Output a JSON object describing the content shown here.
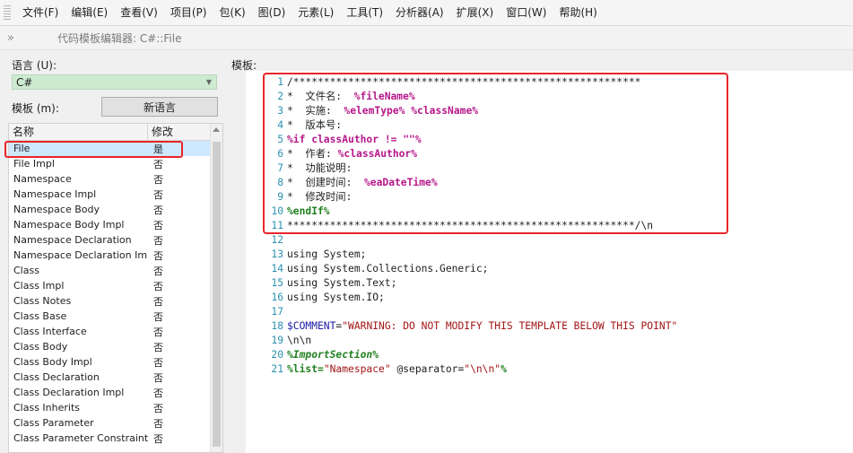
{
  "menu": [
    "文件(F)",
    "编辑(E)",
    "查看(V)",
    "项目(P)",
    "包(K)",
    "图(D)",
    "元素(L)",
    "工具(T)",
    "分析器(A)",
    "扩展(X)",
    "窗口(W)",
    "帮助(H)"
  ],
  "toolbar": {
    "chevron": "»",
    "title": "代码模板编辑器:  C#::File"
  },
  "left": {
    "language_label": "语言 (U):",
    "language_value": "C#",
    "template_label": "模板 (m):",
    "new_language_button": "新语言",
    "col_name": "名称",
    "col_modified": "修改",
    "rows": [
      {
        "name": "File",
        "modified": "是"
      },
      {
        "name": "File Impl",
        "modified": "否"
      },
      {
        "name": "Namespace",
        "modified": "否"
      },
      {
        "name": "Namespace Impl",
        "modified": "否"
      },
      {
        "name": "Namespace Body",
        "modified": "否"
      },
      {
        "name": "Namespace Body Impl",
        "modified": "否"
      },
      {
        "name": "Namespace Declaration",
        "modified": "否"
      },
      {
        "name": "Namespace Declaration Impl",
        "modified": "否"
      },
      {
        "name": "Class",
        "modified": "否"
      },
      {
        "name": "Class Impl",
        "modified": "否"
      },
      {
        "name": "Class Notes",
        "modified": "否"
      },
      {
        "name": "Class Base",
        "modified": "否"
      },
      {
        "name": "Class Interface",
        "modified": "否"
      },
      {
        "name": "Class Body",
        "modified": "否"
      },
      {
        "name": "Class Body Impl",
        "modified": "否"
      },
      {
        "name": "Class Declaration",
        "modified": "否"
      },
      {
        "name": "Class Declaration Impl",
        "modified": "否"
      },
      {
        "name": "Class Inherits",
        "modified": "否"
      },
      {
        "name": "Class Parameter",
        "modified": "否"
      },
      {
        "name": "Class Parameter Constraint",
        "modified": "否"
      }
    ]
  },
  "editor": {
    "label": "模板:",
    "lines": [
      {
        "n": "1",
        "parts": [
          {
            "t": "/*********************************************************",
            "c": "tx"
          }
        ]
      },
      {
        "n": "2",
        "parts": [
          {
            "t": "*  文件名:  ",
            "c": "tx"
          },
          {
            "t": "%fileName%",
            "c": "k-var"
          }
        ]
      },
      {
        "n": "3",
        "parts": [
          {
            "t": "*  实施:  ",
            "c": "tx"
          },
          {
            "t": "%elemType%",
            "c": "k-var"
          },
          {
            "t": " ",
            "c": "tx"
          },
          {
            "t": "%className%",
            "c": "k-var"
          }
        ]
      },
      {
        "n": "4",
        "parts": [
          {
            "t": "*  版本号:",
            "c": "tx"
          }
        ]
      },
      {
        "n": "5",
        "parts": [
          {
            "t": "%if classAuthor != \"\"%",
            "c": "k-var"
          }
        ]
      },
      {
        "n": "6",
        "parts": [
          {
            "t": "*  作者: ",
            "c": "tx"
          },
          {
            "t": "%classAuthor%",
            "c": "k-var"
          }
        ]
      },
      {
        "n": "7",
        "parts": [
          {
            "t": "*  功能说明:",
            "c": "tx"
          }
        ]
      },
      {
        "n": "8",
        "parts": [
          {
            "t": "*  创建时间:  ",
            "c": "tx"
          },
          {
            "t": "%eaDateTime%",
            "c": "k-var"
          }
        ]
      },
      {
        "n": "9",
        "parts": [
          {
            "t": "*  修改时间:",
            "c": "tx"
          }
        ]
      },
      {
        "n": "10",
        "parts": [
          {
            "t": "%endIf%",
            "c": "k-dir"
          }
        ]
      },
      {
        "n": "11",
        "parts": [
          {
            "t": "*********************************************************/\\n",
            "c": "tx"
          }
        ]
      },
      {
        "n": "12",
        "parts": [
          {
            "t": "",
            "c": "tx"
          }
        ]
      },
      {
        "n": "13",
        "parts": [
          {
            "t": "using System;",
            "c": "tx"
          }
        ]
      },
      {
        "n": "14",
        "parts": [
          {
            "t": "using System.Collections.Generic;",
            "c": "tx"
          }
        ]
      },
      {
        "n": "15",
        "parts": [
          {
            "t": "using System.Text;",
            "c": "tx"
          }
        ]
      },
      {
        "n": "16",
        "parts": [
          {
            "t": "using System.IO;",
            "c": "tx"
          }
        ]
      },
      {
        "n": "17",
        "parts": [
          {
            "t": "",
            "c": "tx"
          }
        ]
      },
      {
        "n": "18",
        "parts": [
          {
            "t": "$COMMENT",
            "c": "k-blue"
          },
          {
            "t": "=",
            "c": "tx"
          },
          {
            "t": "\"WARNING: DO NOT MODIFY THIS TEMPLATE BELOW THIS POINT\"",
            "c": "k-str"
          }
        ]
      },
      {
        "n": "19",
        "parts": [
          {
            "t": "\\n\\n",
            "c": "tx"
          }
        ]
      },
      {
        "n": "20",
        "parts": [
          {
            "t": "%ImportSection%",
            "c": "k-ital"
          }
        ]
      },
      {
        "n": "21",
        "parts": [
          {
            "t": "%list=",
            "c": "k-dir"
          },
          {
            "t": "\"Namespace\"",
            "c": "k-str"
          },
          {
            "t": " @separator=",
            "c": "tx"
          },
          {
            "t": "\"\\n\\n\"",
            "c": "k-str"
          },
          {
            "t": "%",
            "c": "k-dir"
          }
        ]
      }
    ]
  },
  "colors": {
    "highlight_border": "#e8262b",
    "selected_row": "#cde8ff",
    "language_select_bg": "#ccebd0"
  }
}
